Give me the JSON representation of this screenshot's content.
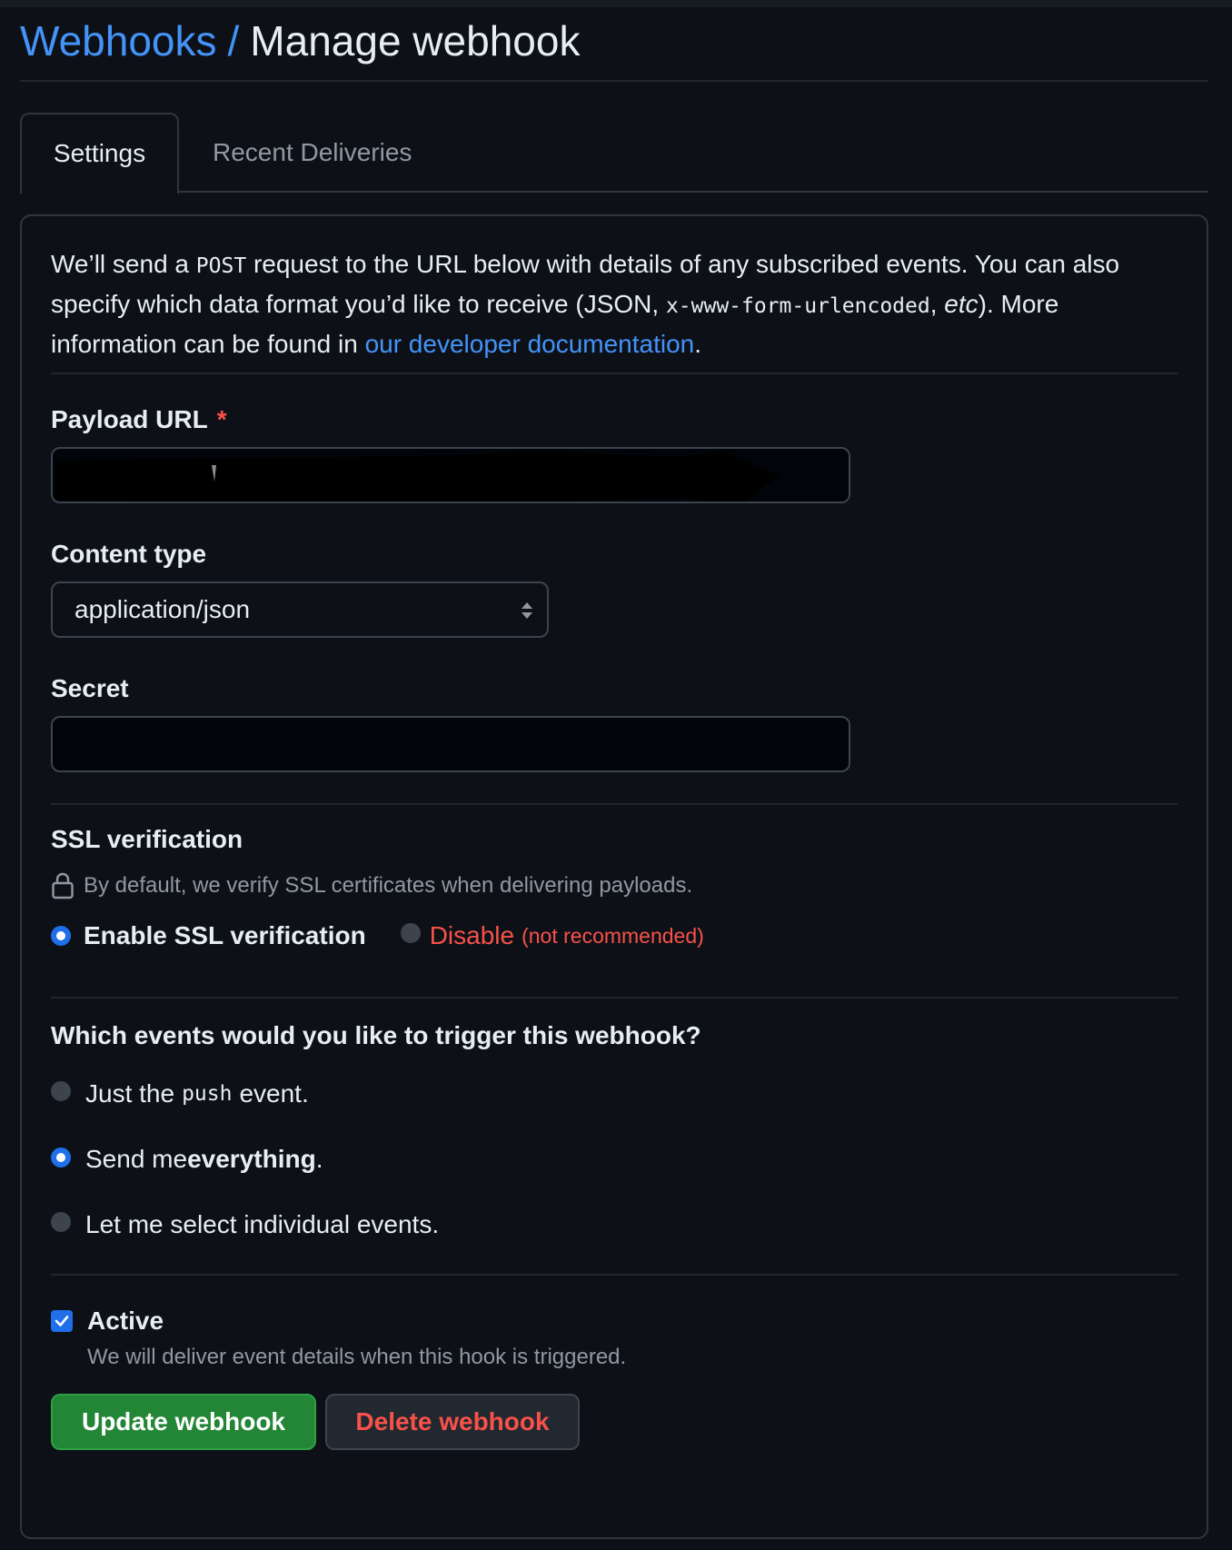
{
  "breadcrumb": {
    "parent": "Webhooks",
    "separator": "/",
    "current": "Manage webhook"
  },
  "tabs": [
    {
      "label": "Settings",
      "selected": true
    },
    {
      "label": "Recent Deliveries",
      "selected": false
    }
  ],
  "intro": {
    "part1": "We’ll send a ",
    "code1": "POST",
    "part2": " request to the URL below with details of any subscribed events. You can also specify which data format you’d like to receive (JSON, ",
    "code2": "x-www-form-urlencoded",
    "part3": ", ",
    "etc": "etc",
    "part4": "). More information can be found in ",
    "link": "our developer documentation",
    "part5": "."
  },
  "payload_url": {
    "label": "Payload URL",
    "required_mark": "*"
  },
  "content_type": {
    "label": "Content type",
    "selected": "application/json"
  },
  "secret": {
    "label": "Secret",
    "value": ""
  },
  "ssl": {
    "heading": "SSL verification",
    "note": "By default, we verify SSL certificates when delivering payloads.",
    "enable_label": "Enable SSL verification",
    "disable_label": "Disable",
    "disable_note": "(not recommended)",
    "selected": "enable"
  },
  "events": {
    "heading": "Which events would you like to trigger this webhook?",
    "opt1_prefix": "Just the ",
    "opt1_code": "push",
    "opt1_suffix": " event.",
    "opt2_prefix": "Send me ",
    "opt2_bold": "everything",
    "opt2_suffix": ".",
    "opt3": "Let me select individual events.",
    "selected": "everything"
  },
  "active": {
    "label": "Active",
    "description": "We will deliver event details when this hook is triggered.",
    "checked": true
  },
  "buttons": {
    "update": "Update webhook",
    "delete": "Delete webhook"
  },
  "colors": {
    "background": "#0d1117",
    "link": "#4493f8",
    "danger": "#f85149",
    "primary_button": "#238636",
    "radio_selected": "#1f6feb"
  }
}
